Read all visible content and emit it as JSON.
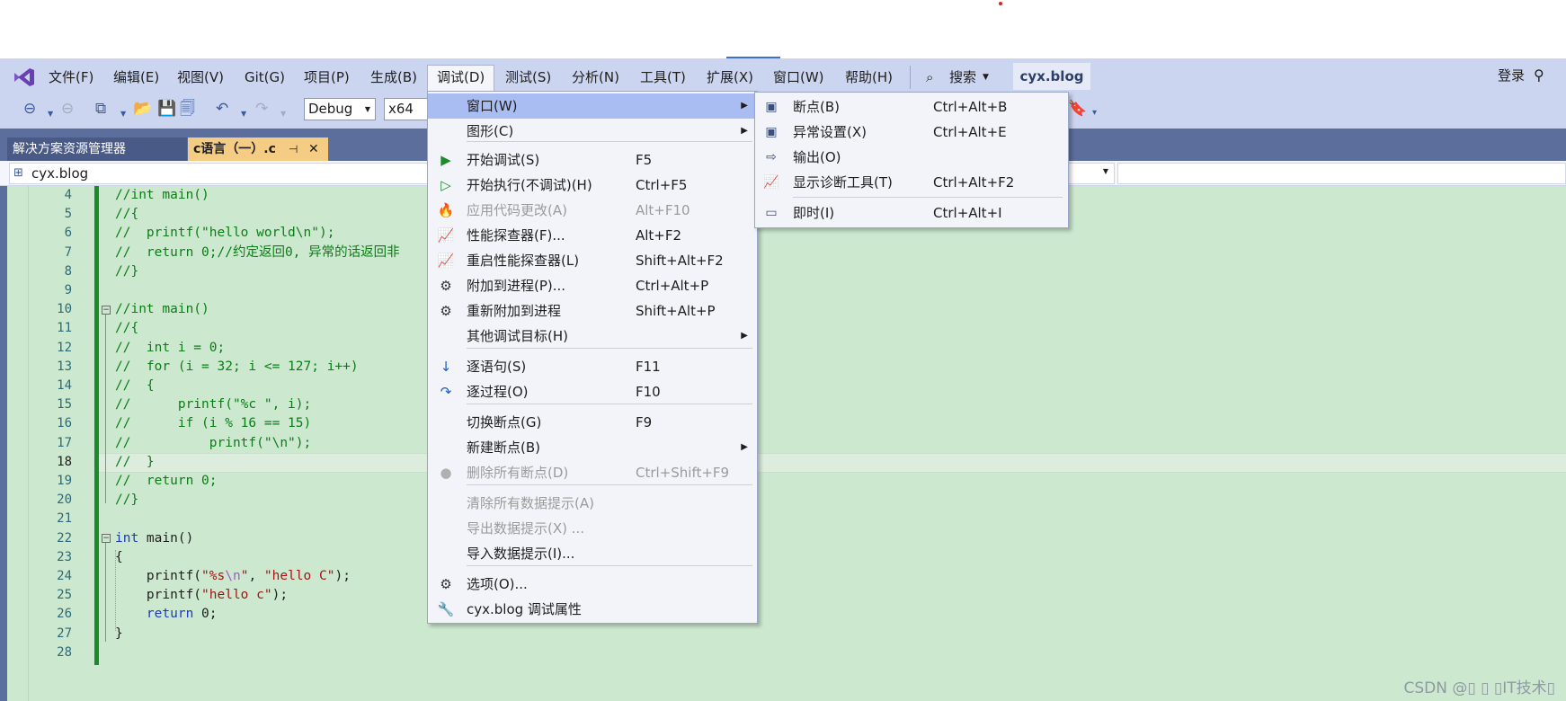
{
  "menubar": {
    "items": [
      "文件(F)",
      "编辑(E)",
      "视图(V)",
      "Git(G)",
      "项目(P)",
      "生成(B)",
      "调试(D)",
      "测试(S)",
      "分析(N)",
      "工具(T)",
      "扩展(X)",
      "窗口(W)",
      "帮助(H)"
    ],
    "search": "搜索",
    "project_badge": "cyx.blog",
    "login": "登录"
  },
  "toolbar": {
    "config": "Debug",
    "platform": "x64"
  },
  "tabs": {
    "solution_explorer": "解决方案资源管理器",
    "file_tab": "c语言（一）.c"
  },
  "navbar": {
    "project": "cyx.blog"
  },
  "code_lines": [
    {
      "n": "4",
      "text": "//int main()"
    },
    {
      "n": "5",
      "text": "//{"
    },
    {
      "n": "6",
      "text": "//  printf(\"hello world\\n\");"
    },
    {
      "n": "7",
      "text": "//  return 0;//约定返回0, 异常的话返回非"
    },
    {
      "n": "8",
      "text": "//}"
    },
    {
      "n": "9",
      "text": ""
    },
    {
      "n": "10",
      "text": "//int main()"
    },
    {
      "n": "11",
      "text": "//{"
    },
    {
      "n": "12",
      "text": "//  int i = 0;"
    },
    {
      "n": "13",
      "text": "//  for (i = 32; i <= 127; i++)"
    },
    {
      "n": "14",
      "text": "//  {"
    },
    {
      "n": "15",
      "text": "//      printf(\"%c \", i);"
    },
    {
      "n": "16",
      "text": "//      if (i % 16 == 15)"
    },
    {
      "n": "17",
      "text": "//          printf(\"\\n\");"
    },
    {
      "n": "18",
      "text": "//  }"
    },
    {
      "n": "19",
      "text": "//  return 0;"
    },
    {
      "n": "20",
      "text": "//}"
    },
    {
      "n": "21",
      "text": ""
    },
    {
      "n": "22",
      "kw": "int",
      "rest": " main()"
    },
    {
      "n": "23",
      "text": "{"
    },
    {
      "n": "24",
      "pre": "    printf(",
      "s1": "\"%s",
      "esc": "\\n",
      "s2": "\"",
      "mid": ", ",
      "s3": "\"hello C\"",
      "post": ");"
    },
    {
      "n": "25",
      "pre": "    printf(",
      "s1": "\"hello c\"",
      "post": ");"
    },
    {
      "n": "26",
      "pre": "    ",
      "kw": "return",
      "rest": " 0;"
    },
    {
      "n": "27",
      "text": "}"
    },
    {
      "n": "28",
      "text": ""
    }
  ],
  "debug_menu": {
    "items": [
      {
        "icon": "",
        "label": "窗口(W)",
        "shortcut": "",
        "submenu": true,
        "disabled": false
      },
      {
        "icon": "",
        "label": "图形(C)",
        "shortcut": "",
        "submenu": true,
        "disabled": false
      },
      {
        "icon": "▶",
        "label": "开始调试(S)",
        "shortcut": "F5",
        "disabled": false
      },
      {
        "icon": "▷",
        "label": "开始执行(不调试)(H)",
        "shortcut": "Ctrl+F5",
        "disabled": false
      },
      {
        "icon": "🔥",
        "label": "应用代码更改(A)",
        "shortcut": "Alt+F10",
        "disabled": true
      },
      {
        "icon": "📈",
        "label": "性能探查器(F)...",
        "shortcut": "Alt+F2",
        "disabled": false
      },
      {
        "icon": "📈",
        "label": "重启性能探查器(L)",
        "shortcut": "Shift+Alt+F2",
        "disabled": false
      },
      {
        "icon": "⚙",
        "label": "附加到进程(P)...",
        "shortcut": "Ctrl+Alt+P",
        "disabled": false
      },
      {
        "icon": "⚙",
        "label": "重新附加到进程",
        "shortcut": "Shift+Alt+P",
        "disabled": false
      },
      {
        "icon": "",
        "label": "其他调试目标(H)",
        "shortcut": "",
        "submenu": true,
        "disabled": false
      },
      {
        "icon": "↓",
        "label": "逐语句(S)",
        "shortcut": "F11",
        "disabled": false
      },
      {
        "icon": "↷",
        "label": "逐过程(O)",
        "shortcut": "F10",
        "disabled": false
      },
      {
        "icon": "",
        "label": "切换断点(G)",
        "shortcut": "F9",
        "disabled": false
      },
      {
        "icon": "",
        "label": "新建断点(B)",
        "shortcut": "",
        "submenu": true,
        "disabled": false
      },
      {
        "icon": "●",
        "label": "删除所有断点(D)",
        "shortcut": "Ctrl+Shift+F9",
        "disabled": true
      },
      {
        "icon": "",
        "label": "清除所有数据提示(A)",
        "shortcut": "",
        "disabled": true
      },
      {
        "icon": "",
        "label": "导出数据提示(X) ...",
        "shortcut": "",
        "disabled": true
      },
      {
        "icon": "",
        "label": "导入数据提示(I)...",
        "shortcut": "",
        "disabled": false
      },
      {
        "icon": "⚙",
        "label": "选项(O)...",
        "shortcut": "",
        "disabled": false
      },
      {
        "icon": "🔧",
        "label": "cyx.blog 调试属性",
        "shortcut": "",
        "disabled": false
      }
    ]
  },
  "window_submenu": {
    "items": [
      {
        "icon": "▣",
        "label": "断点(B)",
        "shortcut": "Ctrl+Alt+B"
      },
      {
        "icon": "▣",
        "label": "异常设置(X)",
        "shortcut": "Ctrl+Alt+E"
      },
      {
        "icon": "⇨",
        "label": "输出(O)",
        "shortcut": ""
      },
      {
        "icon": "📈",
        "label": "显示诊断工具(T)",
        "shortcut": "Ctrl+Alt+F2"
      },
      {
        "icon": "▭",
        "label": "即时(I)",
        "shortcut": "Ctrl+Alt+I"
      }
    ]
  },
  "watermark": "CSDN @▯ ▯ ▯IT技术▯"
}
